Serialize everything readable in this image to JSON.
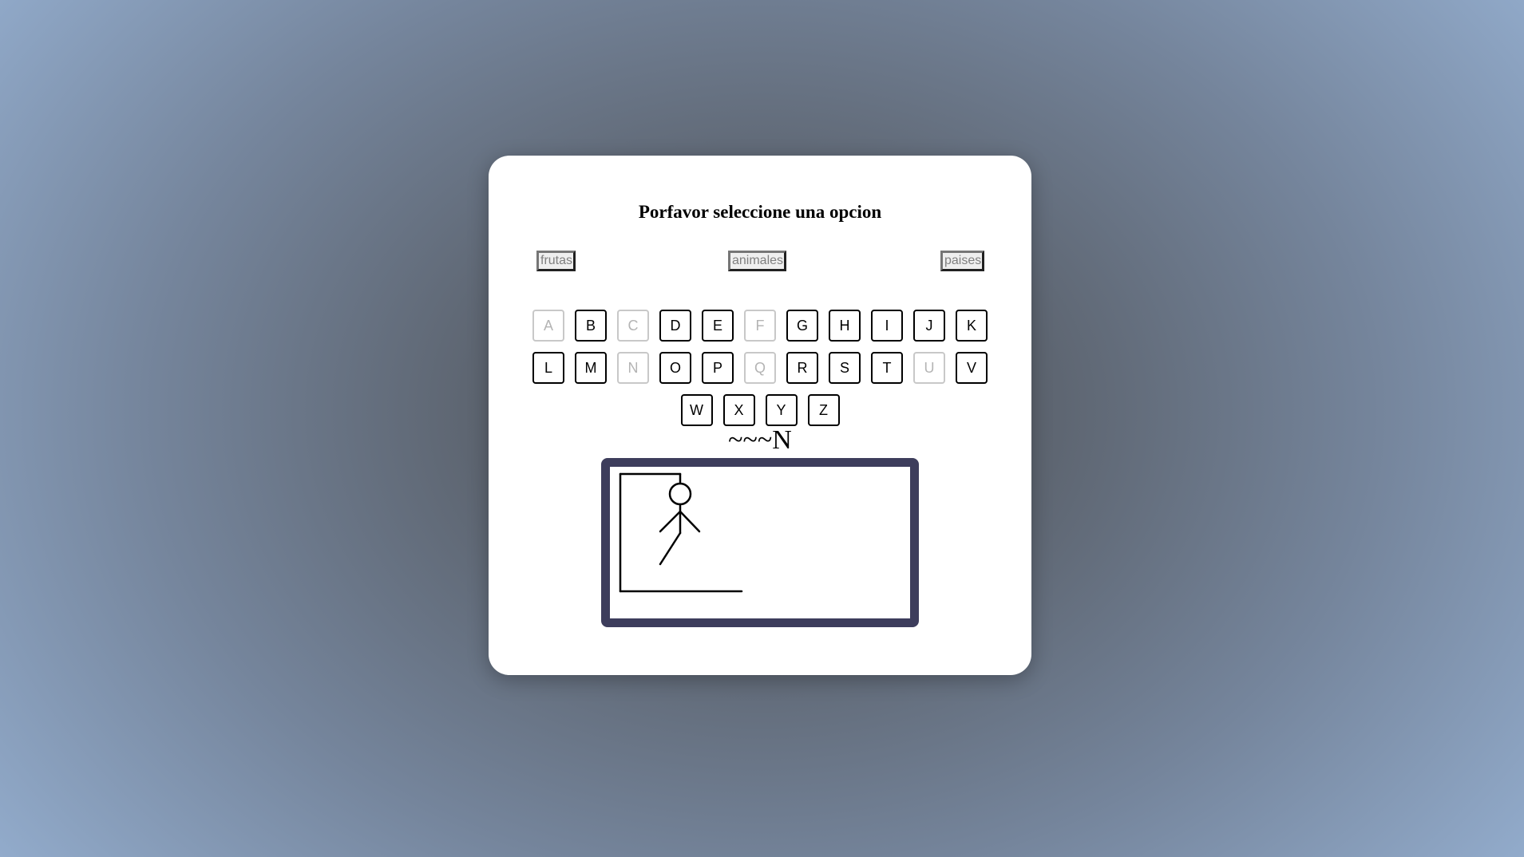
{
  "game": {
    "title": "Porfavor seleccione una opcion",
    "categories": {
      "frutas": "frutas",
      "animales": "animales",
      "paises": "paises"
    },
    "keyboard": {
      "row1": [
        {
          "letter": "A",
          "used": true
        },
        {
          "letter": "B",
          "used": false
        },
        {
          "letter": "C",
          "used": true
        },
        {
          "letter": "D",
          "used": false
        },
        {
          "letter": "E",
          "used": false
        },
        {
          "letter": "F",
          "used": true
        },
        {
          "letter": "G",
          "used": false
        },
        {
          "letter": "H",
          "used": false
        },
        {
          "letter": "I",
          "used": false
        },
        {
          "letter": "J",
          "used": false
        },
        {
          "letter": "K",
          "used": false
        }
      ],
      "row2": [
        {
          "letter": "L",
          "used": false
        },
        {
          "letter": "M",
          "used": false
        },
        {
          "letter": "N",
          "used": true
        },
        {
          "letter": "O",
          "used": false
        },
        {
          "letter": "P",
          "used": false
        },
        {
          "letter": "Q",
          "used": true
        },
        {
          "letter": "R",
          "used": false
        },
        {
          "letter": "S",
          "used": false
        },
        {
          "letter": "T",
          "used": false
        },
        {
          "letter": "U",
          "used": true
        },
        {
          "letter": "V",
          "used": false
        }
      ],
      "row3": [
        {
          "letter": "W",
          "used": false
        },
        {
          "letter": "X",
          "used": false
        },
        {
          "letter": "Y",
          "used": false
        },
        {
          "letter": "Z",
          "used": false
        }
      ]
    },
    "word_display": "~~~N",
    "hangman": {
      "parts_drawn": [
        "gallows",
        "head",
        "body",
        "left-arm",
        "right-arm",
        "left-leg"
      ],
      "frame_color": "#3d3d5c"
    }
  }
}
